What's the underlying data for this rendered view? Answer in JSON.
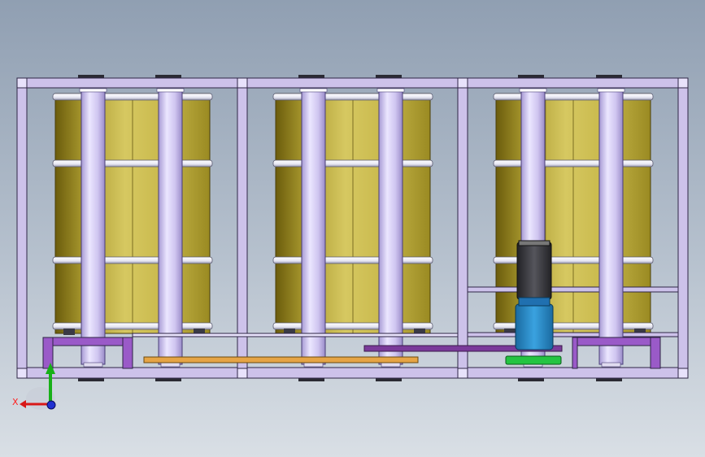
{
  "viewport": {
    "background_top": "#909fb2",
    "background_bottom": "#d9dfe5"
  },
  "colors": {
    "frame": "#cbbfe8",
    "frame_edge": "#3a2f55",
    "column": "#cfc6ee",
    "band": "#ffffff",
    "drum_dark": "#7a6a10",
    "drum_mid": "#c8b84a",
    "drum_light": "#e3d680",
    "motor_body": "#2a8fd0",
    "motor_top": "#3d3d42",
    "motor_base": "#22c040",
    "belt_orange": "#e0a040",
    "belt_purple": "#6a3a8a"
  },
  "model": {
    "bays": 3,
    "columns_per_bay": 2,
    "drum_bands": 4,
    "drive_unit": "motor-gearbox"
  },
  "triad": {
    "x_label": "X",
    "y_color": "#20c020",
    "x_color": "#e02020",
    "z_color": "#2020e0"
  }
}
